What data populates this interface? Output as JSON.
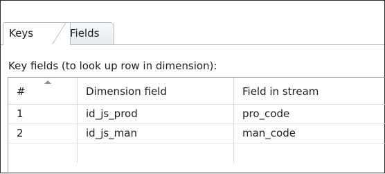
{
  "tabs": [
    {
      "label": "Keys",
      "active": true
    },
    {
      "label": "Fields",
      "active": false
    }
  ],
  "caption": "Key fields (to look up row in dimension):",
  "table": {
    "columns": [
      "#",
      "Dimension field",
      "Field in stream"
    ],
    "sort_icon": "sort-ascending-icon",
    "rows": [
      [
        "1",
        "id_js_prod",
        "pro_code"
      ],
      [
        "2",
        "id_js_man",
        "man_code"
      ],
      [
        "",
        "",
        ""
      ]
    ]
  },
  "colors": {
    "border": "#9aa0a8",
    "grid": "#d8dbe0",
    "text": "#1e1e1e"
  }
}
